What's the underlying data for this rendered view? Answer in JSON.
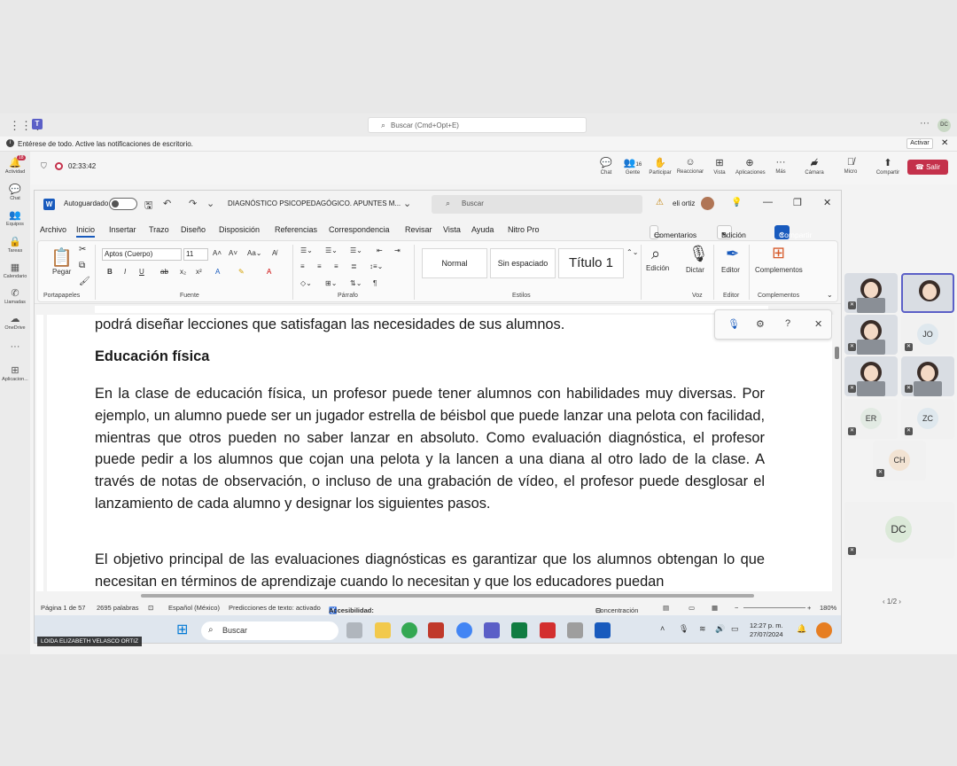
{
  "teams": {
    "search_placeholder": "Buscar (Cmd+Opt+E)",
    "notification": "Entérese de todo. Active las notificaciones de escritorio.",
    "activate_label": "Activar",
    "rail": [
      {
        "label": "Actividad",
        "badge": "18"
      },
      {
        "label": "Chat"
      },
      {
        "label": "Equipos"
      },
      {
        "label": "Tareas"
      },
      {
        "label": "Calendario"
      },
      {
        "label": "Llamadas"
      },
      {
        "label": "OneDrive"
      },
      {
        "label": "Aplicacion..."
      }
    ],
    "meeting": {
      "timer": "02:33:42",
      "controls": [
        {
          "label": "Chat",
          "icon": "chat-icon"
        },
        {
          "label": "Gente",
          "count": "16",
          "icon": "people-icon"
        },
        {
          "label": "Participar",
          "icon": "raise-hand-icon"
        },
        {
          "label": "Reaccionar",
          "icon": "emoji-icon"
        },
        {
          "label": "Vista",
          "icon": "grid-icon"
        },
        {
          "label": "Aplicaciones",
          "icon": "plus-icon"
        },
        {
          "label": "Más",
          "icon": "more-icon"
        },
        {
          "label": "Cámara",
          "icon": "camera-off-icon"
        },
        {
          "label": "Micro",
          "icon": "mic-off-icon"
        },
        {
          "label": "Compartir",
          "icon": "share-icon"
        }
      ],
      "leave_label": "Salir"
    },
    "presenter_name": "LOIDA ELIZABETH VELASCO ORTIZ",
    "participants": [
      "JO",
      "ER",
      "ZC",
      "CH",
      "DC"
    ],
    "pager": "1/2"
  },
  "word": {
    "autosave_label": "Autoguardado",
    "doc_title": "DIAGNÓSTICO PSICOPEDAGÓGICO. APUNTES M...",
    "search_placeholder": "Buscar",
    "user_name": "eli ortiz",
    "menu": [
      "Archivo",
      "Inicio",
      "Insertar",
      "Trazo",
      "Diseño",
      "Disposición",
      "Referencias",
      "Correspondencia",
      "Revisar",
      "Vista",
      "Ayuda",
      "Nitro Pro"
    ],
    "comments_label": "Comentarios",
    "edit_label": "Edición",
    "share_label": "Compartir",
    "ribbon": {
      "paste_label": "Pegar",
      "clipboard_group": "Portapapeles",
      "font_name": "Aptos (Cuerpo)",
      "font_size": "11",
      "font_group": "Fuente",
      "paragraph_group": "Párrafo",
      "styles": [
        "Normal",
        "Sin espaciado",
        "Título 1"
      ],
      "styles_group": "Estilos",
      "edit_btn": "Edición",
      "dictate_btn": "Dictar",
      "voice_group": "Voz",
      "editor_btn": "Editor",
      "editor_group": "Editor",
      "addins_btn": "Complementos",
      "addins_group": "Complementos"
    },
    "document": {
      "line_top": "podrá diseñar lecciones que satisfagan las necesidades de sus alumnos.",
      "heading": "Educación física",
      "paragraph1": "En la clase de educación física, un profesor puede tener alumnos con habilidades muy diversas. Por ejemplo, un alumno puede ser un jugador estrella de béisbol que puede lanzar una pelota con facilidad, mientras que otros pueden no saber lanzar en absoluto. Como evaluación diagnóstica, el profesor puede pedir a los alumnos que cojan una pelota y la lancen a una diana al otro lado de la clase. A través de notas de observación, o incluso de una grabación de vídeo, el profesor puede desglosar el lanzamiento de cada alumno y designar los siguientes pasos.",
      "paragraph2": "El objetivo principal de las evaluaciones diagnósticas es garantizar que los alumnos obtengan lo que necesitan en términos de aprendizaje cuando lo necesitan y que los educadores puedan"
    },
    "status": {
      "page": "Página 1 de 57",
      "words": "2695 palabras",
      "language": "Español (México)",
      "predictions": "Predicciones de texto: activado",
      "accessibility": "Accesibilidad: es necesario investigar",
      "focus": "Concentración",
      "zoom": "180%"
    }
  },
  "taskbar": {
    "search_placeholder": "Buscar",
    "time": "12:27 p. m.",
    "date": "27/07/2024"
  }
}
